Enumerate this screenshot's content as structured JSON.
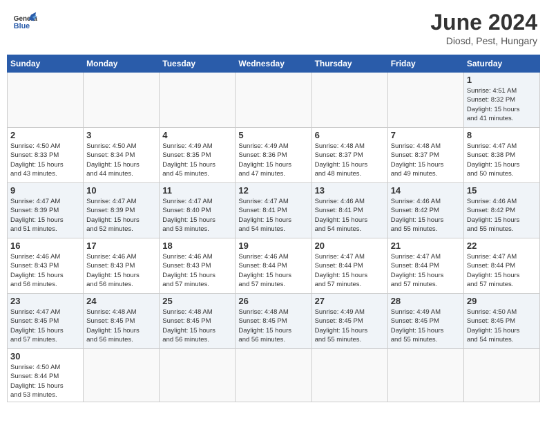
{
  "header": {
    "title": "June 2024",
    "subtitle": "Diosd, Pest, Hungary",
    "logo_general": "General",
    "logo_blue": "Blue"
  },
  "weekdays": [
    "Sunday",
    "Monday",
    "Tuesday",
    "Wednesday",
    "Thursday",
    "Friday",
    "Saturday"
  ],
  "weeks": [
    [
      {
        "day": "",
        "info": ""
      },
      {
        "day": "",
        "info": ""
      },
      {
        "day": "",
        "info": ""
      },
      {
        "day": "",
        "info": ""
      },
      {
        "day": "",
        "info": ""
      },
      {
        "day": "",
        "info": ""
      },
      {
        "day": "1",
        "info": "Sunrise: 4:51 AM\nSunset: 8:32 PM\nDaylight: 15 hours\nand 41 minutes."
      }
    ],
    [
      {
        "day": "2",
        "info": "Sunrise: 4:50 AM\nSunset: 8:33 PM\nDaylight: 15 hours\nand 43 minutes."
      },
      {
        "day": "3",
        "info": "Sunrise: 4:50 AM\nSunset: 8:34 PM\nDaylight: 15 hours\nand 44 minutes."
      },
      {
        "day": "4",
        "info": "Sunrise: 4:49 AM\nSunset: 8:35 PM\nDaylight: 15 hours\nand 45 minutes."
      },
      {
        "day": "5",
        "info": "Sunrise: 4:49 AM\nSunset: 8:36 PM\nDaylight: 15 hours\nand 47 minutes."
      },
      {
        "day": "6",
        "info": "Sunrise: 4:48 AM\nSunset: 8:37 PM\nDaylight: 15 hours\nand 48 minutes."
      },
      {
        "day": "7",
        "info": "Sunrise: 4:48 AM\nSunset: 8:37 PM\nDaylight: 15 hours\nand 49 minutes."
      },
      {
        "day": "8",
        "info": "Sunrise: 4:47 AM\nSunset: 8:38 PM\nDaylight: 15 hours\nand 50 minutes."
      }
    ],
    [
      {
        "day": "9",
        "info": "Sunrise: 4:47 AM\nSunset: 8:39 PM\nDaylight: 15 hours\nand 51 minutes."
      },
      {
        "day": "10",
        "info": "Sunrise: 4:47 AM\nSunset: 8:39 PM\nDaylight: 15 hours\nand 52 minutes."
      },
      {
        "day": "11",
        "info": "Sunrise: 4:47 AM\nSunset: 8:40 PM\nDaylight: 15 hours\nand 53 minutes."
      },
      {
        "day": "12",
        "info": "Sunrise: 4:47 AM\nSunset: 8:41 PM\nDaylight: 15 hours\nand 54 minutes."
      },
      {
        "day": "13",
        "info": "Sunrise: 4:46 AM\nSunset: 8:41 PM\nDaylight: 15 hours\nand 54 minutes."
      },
      {
        "day": "14",
        "info": "Sunrise: 4:46 AM\nSunset: 8:42 PM\nDaylight: 15 hours\nand 55 minutes."
      },
      {
        "day": "15",
        "info": "Sunrise: 4:46 AM\nSunset: 8:42 PM\nDaylight: 15 hours\nand 55 minutes."
      }
    ],
    [
      {
        "day": "16",
        "info": "Sunrise: 4:46 AM\nSunset: 8:43 PM\nDaylight: 15 hours\nand 56 minutes."
      },
      {
        "day": "17",
        "info": "Sunrise: 4:46 AM\nSunset: 8:43 PM\nDaylight: 15 hours\nand 56 minutes."
      },
      {
        "day": "18",
        "info": "Sunrise: 4:46 AM\nSunset: 8:43 PM\nDaylight: 15 hours\nand 57 minutes."
      },
      {
        "day": "19",
        "info": "Sunrise: 4:46 AM\nSunset: 8:44 PM\nDaylight: 15 hours\nand 57 minutes."
      },
      {
        "day": "20",
        "info": "Sunrise: 4:47 AM\nSunset: 8:44 PM\nDaylight: 15 hours\nand 57 minutes."
      },
      {
        "day": "21",
        "info": "Sunrise: 4:47 AM\nSunset: 8:44 PM\nDaylight: 15 hours\nand 57 minutes."
      },
      {
        "day": "22",
        "info": "Sunrise: 4:47 AM\nSunset: 8:44 PM\nDaylight: 15 hours\nand 57 minutes."
      }
    ],
    [
      {
        "day": "23",
        "info": "Sunrise: 4:47 AM\nSunset: 8:45 PM\nDaylight: 15 hours\nand 57 minutes."
      },
      {
        "day": "24",
        "info": "Sunrise: 4:48 AM\nSunset: 8:45 PM\nDaylight: 15 hours\nand 56 minutes."
      },
      {
        "day": "25",
        "info": "Sunrise: 4:48 AM\nSunset: 8:45 PM\nDaylight: 15 hours\nand 56 minutes."
      },
      {
        "day": "26",
        "info": "Sunrise: 4:48 AM\nSunset: 8:45 PM\nDaylight: 15 hours\nand 56 minutes."
      },
      {
        "day": "27",
        "info": "Sunrise: 4:49 AM\nSunset: 8:45 PM\nDaylight: 15 hours\nand 55 minutes."
      },
      {
        "day": "28",
        "info": "Sunrise: 4:49 AM\nSunset: 8:45 PM\nDaylight: 15 hours\nand 55 minutes."
      },
      {
        "day": "29",
        "info": "Sunrise: 4:50 AM\nSunset: 8:45 PM\nDaylight: 15 hours\nand 54 minutes."
      }
    ],
    [
      {
        "day": "30",
        "info": "Sunrise: 4:50 AM\nSunset: 8:44 PM\nDaylight: 15 hours\nand 53 minutes."
      },
      {
        "day": "",
        "info": ""
      },
      {
        "day": "",
        "info": ""
      },
      {
        "day": "",
        "info": ""
      },
      {
        "day": "",
        "info": ""
      },
      {
        "day": "",
        "info": ""
      },
      {
        "day": "",
        "info": ""
      }
    ]
  ]
}
